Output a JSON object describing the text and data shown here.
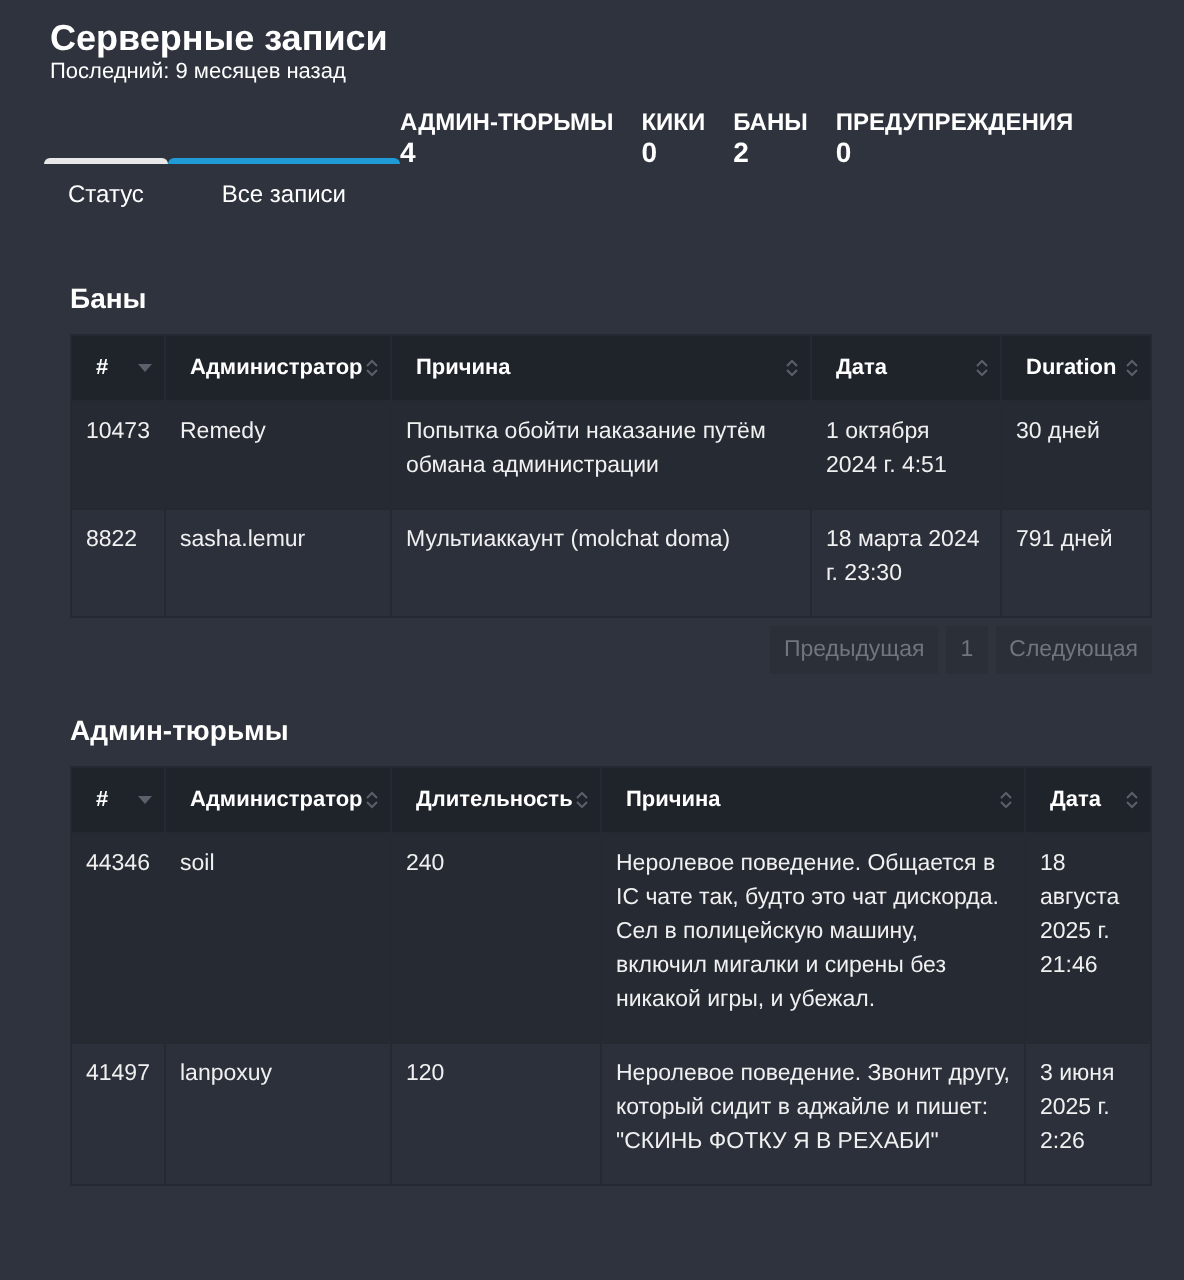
{
  "header": {
    "title": "Серверные записи",
    "subtitle": "Последний: 9 месяцев назад"
  },
  "stats": [
    {
      "label": "АДМИН-ТЮРЬМЫ",
      "value": "4"
    },
    {
      "label": "КИКИ",
      "value": "0"
    },
    {
      "label": "БАНЫ",
      "value": "2"
    },
    {
      "label": "ПРЕДУПРЕЖДЕНИЯ",
      "value": "0"
    }
  ],
  "tabs": [
    {
      "label": "Статус",
      "selected": false
    },
    {
      "label": "Все записи",
      "selected": true
    }
  ],
  "sections": [
    {
      "title": "Баны",
      "columns": [
        {
          "label": "#",
          "sorted": true
        },
        {
          "label": "Администратор",
          "sorted": false
        },
        {
          "label": "Причина",
          "sorted": false
        },
        {
          "label": "Дата",
          "sorted": false
        },
        {
          "label": "Duration",
          "sorted": false
        }
      ],
      "rows": [
        [
          "10473",
          "Remedy",
          "Попытка обойти наказание путём обмана администрации",
          "1 октября 2024 г. 4:51",
          "30 дней"
        ],
        [
          "8822",
          "sasha.lemur",
          "Мультиаккаунт (molchat doma)",
          "18 марта 2024 г. 23:30",
          "791 дней"
        ]
      ],
      "pagination": {
        "previous": "Предыдущая",
        "page": "1",
        "next": "Следующая"
      }
    },
    {
      "title": "Админ-тюрьмы",
      "columns": [
        {
          "label": "#",
          "sorted": true
        },
        {
          "label": "Администратор",
          "sorted": false
        },
        {
          "label": "Длительность",
          "sorted": false
        },
        {
          "label": "Причина",
          "sorted": false
        },
        {
          "label": "Дата",
          "sorted": false
        }
      ],
      "rows": [
        [
          "44346",
          "soil",
          "240",
          "Неролевое поведение. Общается в IC чате так, будто это чат дискорда. Сел в полицейскую машину, включил мигалки и сирены без никакой игры, и убежал.",
          "18 августа 2025 г. 21:46"
        ],
        [
          "41497",
          "lanpoxuy",
          "120",
          "Неролевое поведение. Звонит другу, который сидит в аджайле и пишет: \"СКИНЬ ФОТКУ Я В РЕХАБИ\"",
          "3 июня 2025 г. 2:26"
        ]
      ]
    }
  ]
}
